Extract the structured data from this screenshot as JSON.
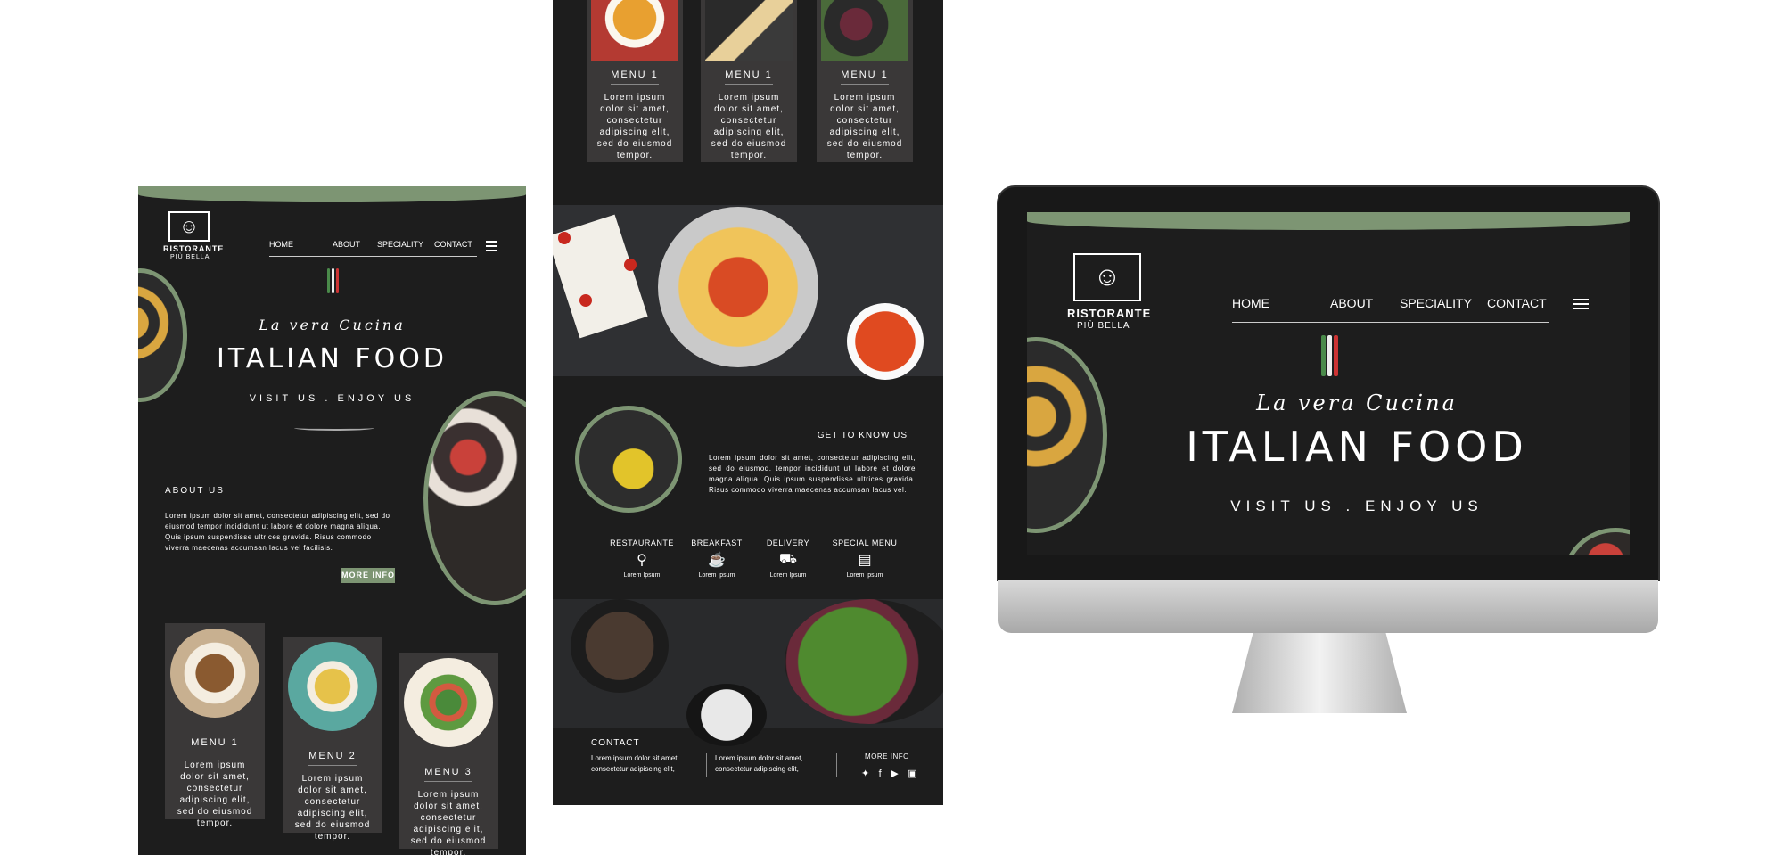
{
  "brand": {
    "name": "RISTORANTE",
    "sub": "PIÙ BELLA"
  },
  "nav": {
    "home": "HOME",
    "about": "ABOUT",
    "speciality": "SPECIALITY",
    "contact": "CONTACT"
  },
  "hero": {
    "script": "La vera Cucina",
    "title": "ITALIAN FOOD",
    "tagline": "VISIT US . ENJOY US"
  },
  "about": {
    "heading": "ABOUT US",
    "text": "Lorem ipsum dolor sit amet, consectetur adipiscing elit, sed do eiusmod tempor incididunt ut labore et dolore magna aliqua. Quis ipsum suspendisse ultrices gravida. Risus commodo viverra maecenas accumsan lacus vel facilisis.",
    "button": "MORE INFO"
  },
  "menu_cards_left": [
    {
      "title": "MENU 1",
      "text": "Lorem ipsum dolor sit amet, consectetur adipiscing elit, sed do eiusmod tempor."
    },
    {
      "title": "MENU 2",
      "text": "Lorem ipsum dolor sit amet, consectetur adipiscing elit, sed do eiusmod tempor."
    },
    {
      "title": "MENU 3",
      "text": "Lorem ipsum dolor sit amet, consectetur adipiscing elit, sed do eiusmod tempor."
    }
  ],
  "menu_cards_middle": [
    {
      "title": "MENU 1",
      "text": "Lorem ipsum dolor sit amet, consectetur adipiscing elit, sed do eiusmod tempor."
    },
    {
      "title": "MENU 1",
      "text": "Lorem ipsum dolor sit amet, consectetur adipiscing elit, sed do eiusmod tempor."
    },
    {
      "title": "MENU 1",
      "text": "Lorem ipsum dolor sit amet, consectetur adipiscing elit, sed do eiusmod tempor."
    }
  ],
  "get_to_know": {
    "heading": "GET TO KNOW US",
    "text": "Lorem ipsum dolor sit amet, consectetur adipiscing elit, sed do eiusmod. tempor incididunt ut labore et dolore magna aliqua. Quis ipsum suspendisse ultrices gravida. Risus commodo viverra maecenas accumsan lacus vel."
  },
  "features": [
    {
      "title": "RESTAURANTE",
      "icon": "cutlery-icon",
      "label": "Lorem Ipsum"
    },
    {
      "title": "BREAKFAST",
      "icon": "coffee-icon",
      "label": "Lorem Ipsum"
    },
    {
      "title": "DELIVERY",
      "icon": "truck-icon",
      "label": "Lorem Ipsum"
    },
    {
      "title": "SPECIAL MENU",
      "icon": "menu-icon",
      "label": "Lorem Ipsum"
    }
  ],
  "contact": {
    "heading": "CONTACT",
    "col1": "Lorem ipsum dolor sit amet, consectetur adipiscing elit,",
    "col2": "Lorem ipsum dolor sit amet, consectetur adipiscing elit,",
    "more": "MORE INFO"
  },
  "colors": {
    "accent": "#7d9573",
    "bg": "#1d1d1d",
    "card": "#3a3838"
  }
}
